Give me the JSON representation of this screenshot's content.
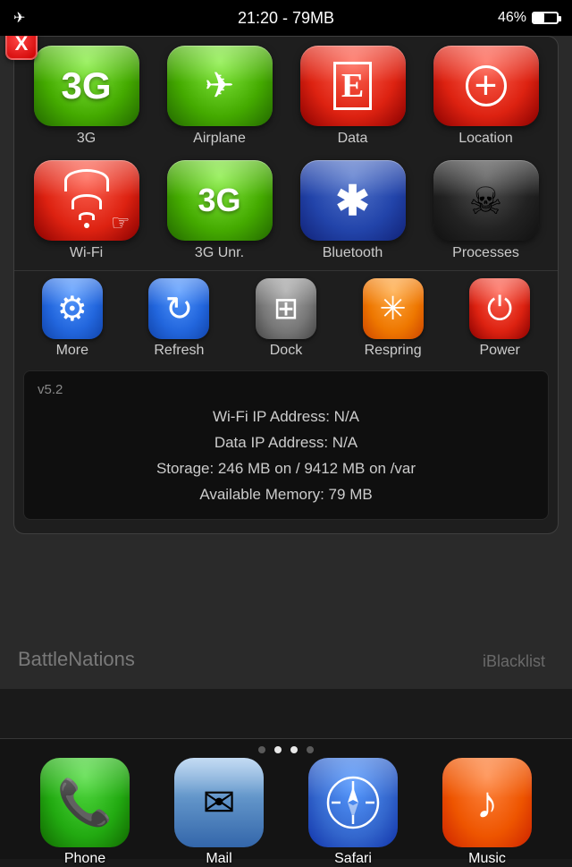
{
  "statusBar": {
    "leftIcon": "airplane",
    "timeMemory": "21:20 - 79MB",
    "batteryPercent": "46%"
  },
  "panel": {
    "closeLabel": "X",
    "row1": [
      {
        "id": "3g",
        "label": "3G",
        "state": "green",
        "iconType": "3g"
      },
      {
        "id": "airplane",
        "label": "Airplane",
        "state": "green",
        "iconType": "airplane"
      },
      {
        "id": "data",
        "label": "Data",
        "state": "red",
        "iconType": "data-e"
      },
      {
        "id": "location",
        "label": "Location",
        "state": "red",
        "iconType": "crosshair"
      }
    ],
    "row2": [
      {
        "id": "wifi",
        "label": "Wi-Fi",
        "state": "red",
        "iconType": "wifi"
      },
      {
        "id": "3gunr",
        "label": "3G Unr.",
        "state": "green",
        "iconType": "3gunr"
      },
      {
        "id": "bluetooth",
        "label": "Bluetooth",
        "state": "blue-dark",
        "iconType": "bluetooth"
      },
      {
        "id": "processes",
        "label": "Processes",
        "state": "dark",
        "iconType": "skull"
      }
    ],
    "toolbar": [
      {
        "id": "more",
        "label": "More",
        "iconType": "gear",
        "color": "blue-grad"
      },
      {
        "id": "refresh",
        "label": "Refresh",
        "iconType": "refresh",
        "color": "blue-grad"
      },
      {
        "id": "dock",
        "label": "Dock",
        "iconType": "appstore",
        "color": "gray-grad"
      },
      {
        "id": "respring",
        "label": "Respring",
        "iconType": "respring",
        "color": "orange-grad"
      },
      {
        "id": "power",
        "label": "Power",
        "iconType": "power",
        "color": "red-grad"
      }
    ],
    "info": {
      "version": "v5.2",
      "line1": "Wi-Fi IP Address: N/A",
      "line2": "Data IP Address: N/A",
      "line3": "Storage: 246 MB on / 9412 MB on /var",
      "line4": "Available Memory: 79 MB"
    }
  },
  "bgApps": {
    "hint1": "BattleNations",
    "hint2": "iBlacklist"
  },
  "dock": {
    "dots": [
      false,
      true,
      true,
      false
    ],
    "apps": [
      {
        "id": "phone",
        "label": "Phone",
        "color": "dock-phone"
      },
      {
        "id": "mail",
        "label": "Mail",
        "color": "dock-mail"
      },
      {
        "id": "safari",
        "label": "Safari",
        "color": "dock-safari"
      },
      {
        "id": "music",
        "label": "Music",
        "color": "dock-music"
      }
    ]
  }
}
